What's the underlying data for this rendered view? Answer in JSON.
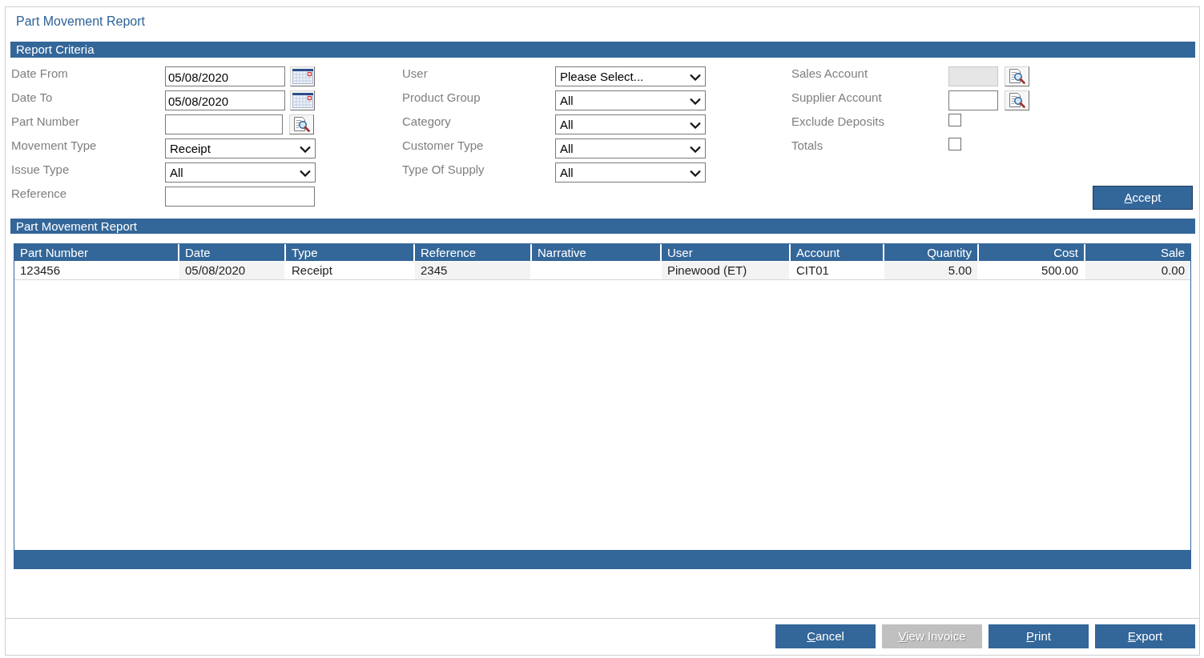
{
  "title": "Part Movement Report",
  "criteria": {
    "header": "Report Criteria",
    "columns": [
      {
        "fields": [
          {
            "label": "Date From",
            "kind": "date",
            "value": "05/08/2020",
            "disabled": false
          },
          {
            "label": "Date To",
            "kind": "date",
            "value": "05/08/2020",
            "disabled": false
          },
          {
            "label": "Part Number",
            "kind": "lookup",
            "disabled": false
          },
          {
            "label": "Movement Type",
            "kind": "select",
            "value": "Receipt",
            "disabled": false
          },
          {
            "label": "Issue Type",
            "kind": "select",
            "value": "All",
            "disabled": false
          },
          {
            "label": "Reference",
            "kind": "text",
            "disabled": false
          }
        ]
      },
      {
        "fields": [
          {
            "label": "User",
            "kind": "select",
            "value": "Please Select...",
            "disabled": false
          },
          {
            "label": "Product Group",
            "kind": "select",
            "value": "All",
            "disabled": false
          },
          {
            "label": "Category",
            "kind": "select",
            "value": "All",
            "disabled": false
          },
          {
            "label": "Customer Type",
            "kind": "select",
            "value": "All",
            "disabled": false
          },
          {
            "label": "Type Of Supply",
            "kind": "select",
            "value": "All",
            "disabled": false
          }
        ]
      },
      {
        "fields": [
          {
            "label": "Sales Account",
            "kind": "lookup",
            "disabled": true
          },
          {
            "label": "Supplier Account",
            "kind": "lookup",
            "disabled": false
          },
          {
            "label": "Exclude Deposits",
            "kind": "checkbox",
            "checked": false,
            "disabled": false
          },
          {
            "label": "Totals",
            "kind": "checkbox",
            "checked": false,
            "disabled": false
          }
        ]
      }
    ],
    "accept_button": {
      "label": "Accept"
    }
  },
  "report": {
    "header": "Part Movement Report",
    "table": {
      "columns": [
        {
          "label": "Part Number",
          "kind": "text"
        },
        {
          "label": "Date",
          "kind": "text"
        },
        {
          "label": "Type",
          "kind": "text"
        },
        {
          "label": "Reference",
          "kind": "text"
        },
        {
          "label": "Narrative",
          "kind": "text"
        },
        {
          "label": "User",
          "kind": "text"
        },
        {
          "label": "Account",
          "kind": "text"
        },
        {
          "label": "Quantity",
          "kind": "number"
        },
        {
          "label": "Cost",
          "kind": "number"
        },
        {
          "label": "Sale",
          "kind": "number"
        }
      ],
      "rows": [
        {
          "cells": [
            "123456",
            "05/08/2020",
            "Receipt",
            "2345",
            null,
            "Pinewood (ET)",
            "CIT01",
            "5.00",
            "500.00",
            "0.00"
          ]
        }
      ]
    }
  },
  "buttons": [
    {
      "label": "Cancel",
      "disabled": false
    },
    {
      "label": "View Invoice",
      "disabled": true
    },
    {
      "label": "Print",
      "disabled": false
    },
    {
      "label": "Export",
      "disabled": false
    }
  ]
}
